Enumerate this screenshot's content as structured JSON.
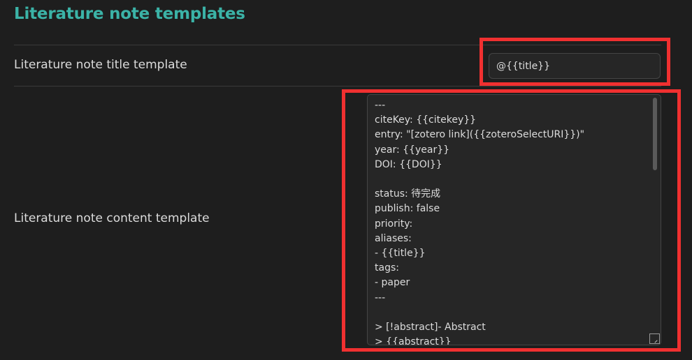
{
  "section": {
    "title": "Literature note templates"
  },
  "settings": [
    {
      "name": "Literature note title template",
      "value": "@{{title}}"
    },
    {
      "name": "Literature note content template",
      "value": "---\nciteKey: {{citekey}}\nentry: \"[zotero link]({{zoteroSelectURI}})\"\nyear: {{year}}\nDOI: {{DOI}}\n\nstatus: 待完成\npublish: false\npriority:\naliases:\n- {{title}}\ntags:\n- paper\n---\n\n> [!abstract]- Abstract\n> {{abstract}}"
    }
  ],
  "annotation": {
    "highlight_color": "#f03030"
  },
  "theme": {
    "accent": "#3bb3a7",
    "background": "#1e1e1e"
  }
}
